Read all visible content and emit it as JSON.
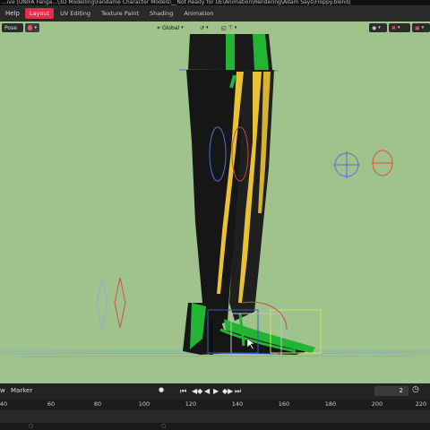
{
  "window": {
    "title": "...ive [UNIFA Fanga...\\3D Modelling\\Fandame Character Models\\__Not Ready for UE\\Animation\\Rendering\\Adam Says\\Floppy.blend]"
  },
  "menu": {
    "help_label": "Help"
  },
  "workspace_tabs": [
    {
      "label": "Layout",
      "active": true
    },
    {
      "label": "UV Editing",
      "active": false
    },
    {
      "label": "Texture Paint",
      "active": false
    },
    {
      "label": "Shading",
      "active": false
    },
    {
      "label": "Animation",
      "active": false
    }
  ],
  "viewport_header": {
    "mode": "Pose",
    "transform_orientation": "Global"
  },
  "timeline": {
    "marker_label": "Marker",
    "left_cut_label": "w",
    "current_frame": "2",
    "ruler_ticks": [
      "40",
      "60",
      "80",
      "100",
      "120",
      "140",
      "160",
      "180",
      "200",
      "220"
    ]
  },
  "colors": {
    "viewport_bg": "#a0c28d",
    "active_tab": "#e0304a",
    "boot_black": "#161616",
    "stripe_yellow": "#e8c234",
    "stripe_green": "#22b534"
  }
}
